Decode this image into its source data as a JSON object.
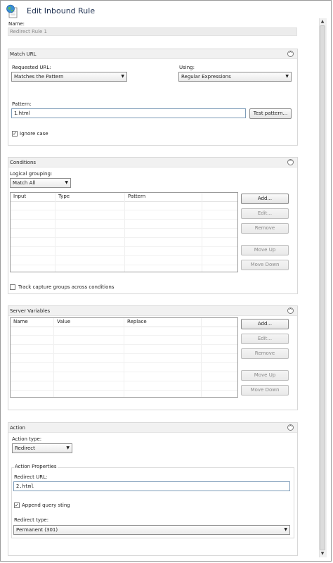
{
  "window": {
    "title": "Edit Inbound Rule"
  },
  "name_field": {
    "label": "Name:",
    "value": "Redirect Rule 1"
  },
  "match_url": {
    "title": "Match URL",
    "requested_url_label": "Requested URL:",
    "requested_url_value": "Matches the Pattern",
    "using_label": "Using:",
    "using_value": "Regular Expressions",
    "pattern_label": "Pattern:",
    "pattern_value": "1.html",
    "test_pattern_button": "Test pattern...",
    "ignore_case_label": "Ignore case",
    "ignore_case_checked": true
  },
  "conditions": {
    "title": "Conditions",
    "logical_grouping_label": "Logical grouping:",
    "logical_grouping_value": "Match All",
    "columns": [
      "Input",
      "Type",
      "Pattern"
    ],
    "buttons": {
      "add": "Add...",
      "edit": "Edit...",
      "remove": "Remove",
      "move_up": "Move Up",
      "move_down": "Move Down"
    },
    "track_label": "Track capture groups across conditions",
    "track_checked": false
  },
  "server_variables": {
    "title": "Server Variables",
    "columns": [
      "Name",
      "Value",
      "Replace"
    ],
    "buttons": {
      "add": "Add...",
      "edit": "Edit...",
      "remove": "Remove",
      "move_up": "Move Up",
      "move_down": "Move Down"
    }
  },
  "action": {
    "title": "Action",
    "action_type_label": "Action type:",
    "action_type_value": "Redirect",
    "properties_title": "Action Properties",
    "redirect_url_label": "Redirect URL:",
    "redirect_url_value": "2.html",
    "append_query_label": "Append query sting",
    "append_query_checked": true,
    "redirect_type_label": "Redirect type:",
    "redirect_type_value": "Permanent (301)"
  },
  "icons": {
    "app": "iis-globe-document-icon",
    "collapse": "collapse-up-icon",
    "dropdown": "chevron-down-icon",
    "check": "checkmark-icon"
  },
  "colors": {
    "title_text": "#1e3050",
    "input_border": "#7f9db9",
    "group_header": "#f1f1f1"
  }
}
